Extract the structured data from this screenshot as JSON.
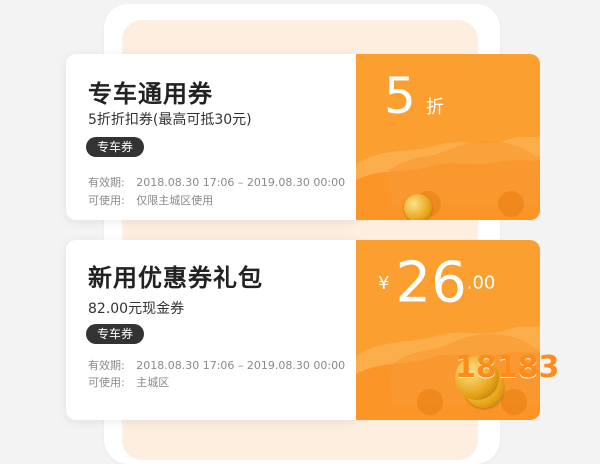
{
  "coupons": [
    {
      "title": "专车通用券",
      "subtitle": "5折折扣券(最高可抵30元)",
      "tag": "专车券",
      "validity_label": "有效期:",
      "validity_value": "2018.08.30 17:06 – 2019.08.30 00:00",
      "usage_label": "可使用:",
      "usage_value": "仅限主城区使用",
      "value": "5",
      "unit": "折"
    },
    {
      "title": "新用优惠券礼包",
      "subtitle": "82.00元现金券",
      "tag": "专车券",
      "validity_label": "有效期:",
      "validity_value": "2018.08.30 17:06 – 2019.08.30 00:00",
      "usage_label": "可使用:",
      "usage_value": "主城区",
      "currency": "¥",
      "amount_main": "26",
      "amount_cents": ".00"
    }
  ],
  "watermark": {
    "text": "18183"
  },
  "colors": {
    "accent": "#fb9f31",
    "tag_background": "#333333",
    "page_background": "#f3f3f3"
  }
}
